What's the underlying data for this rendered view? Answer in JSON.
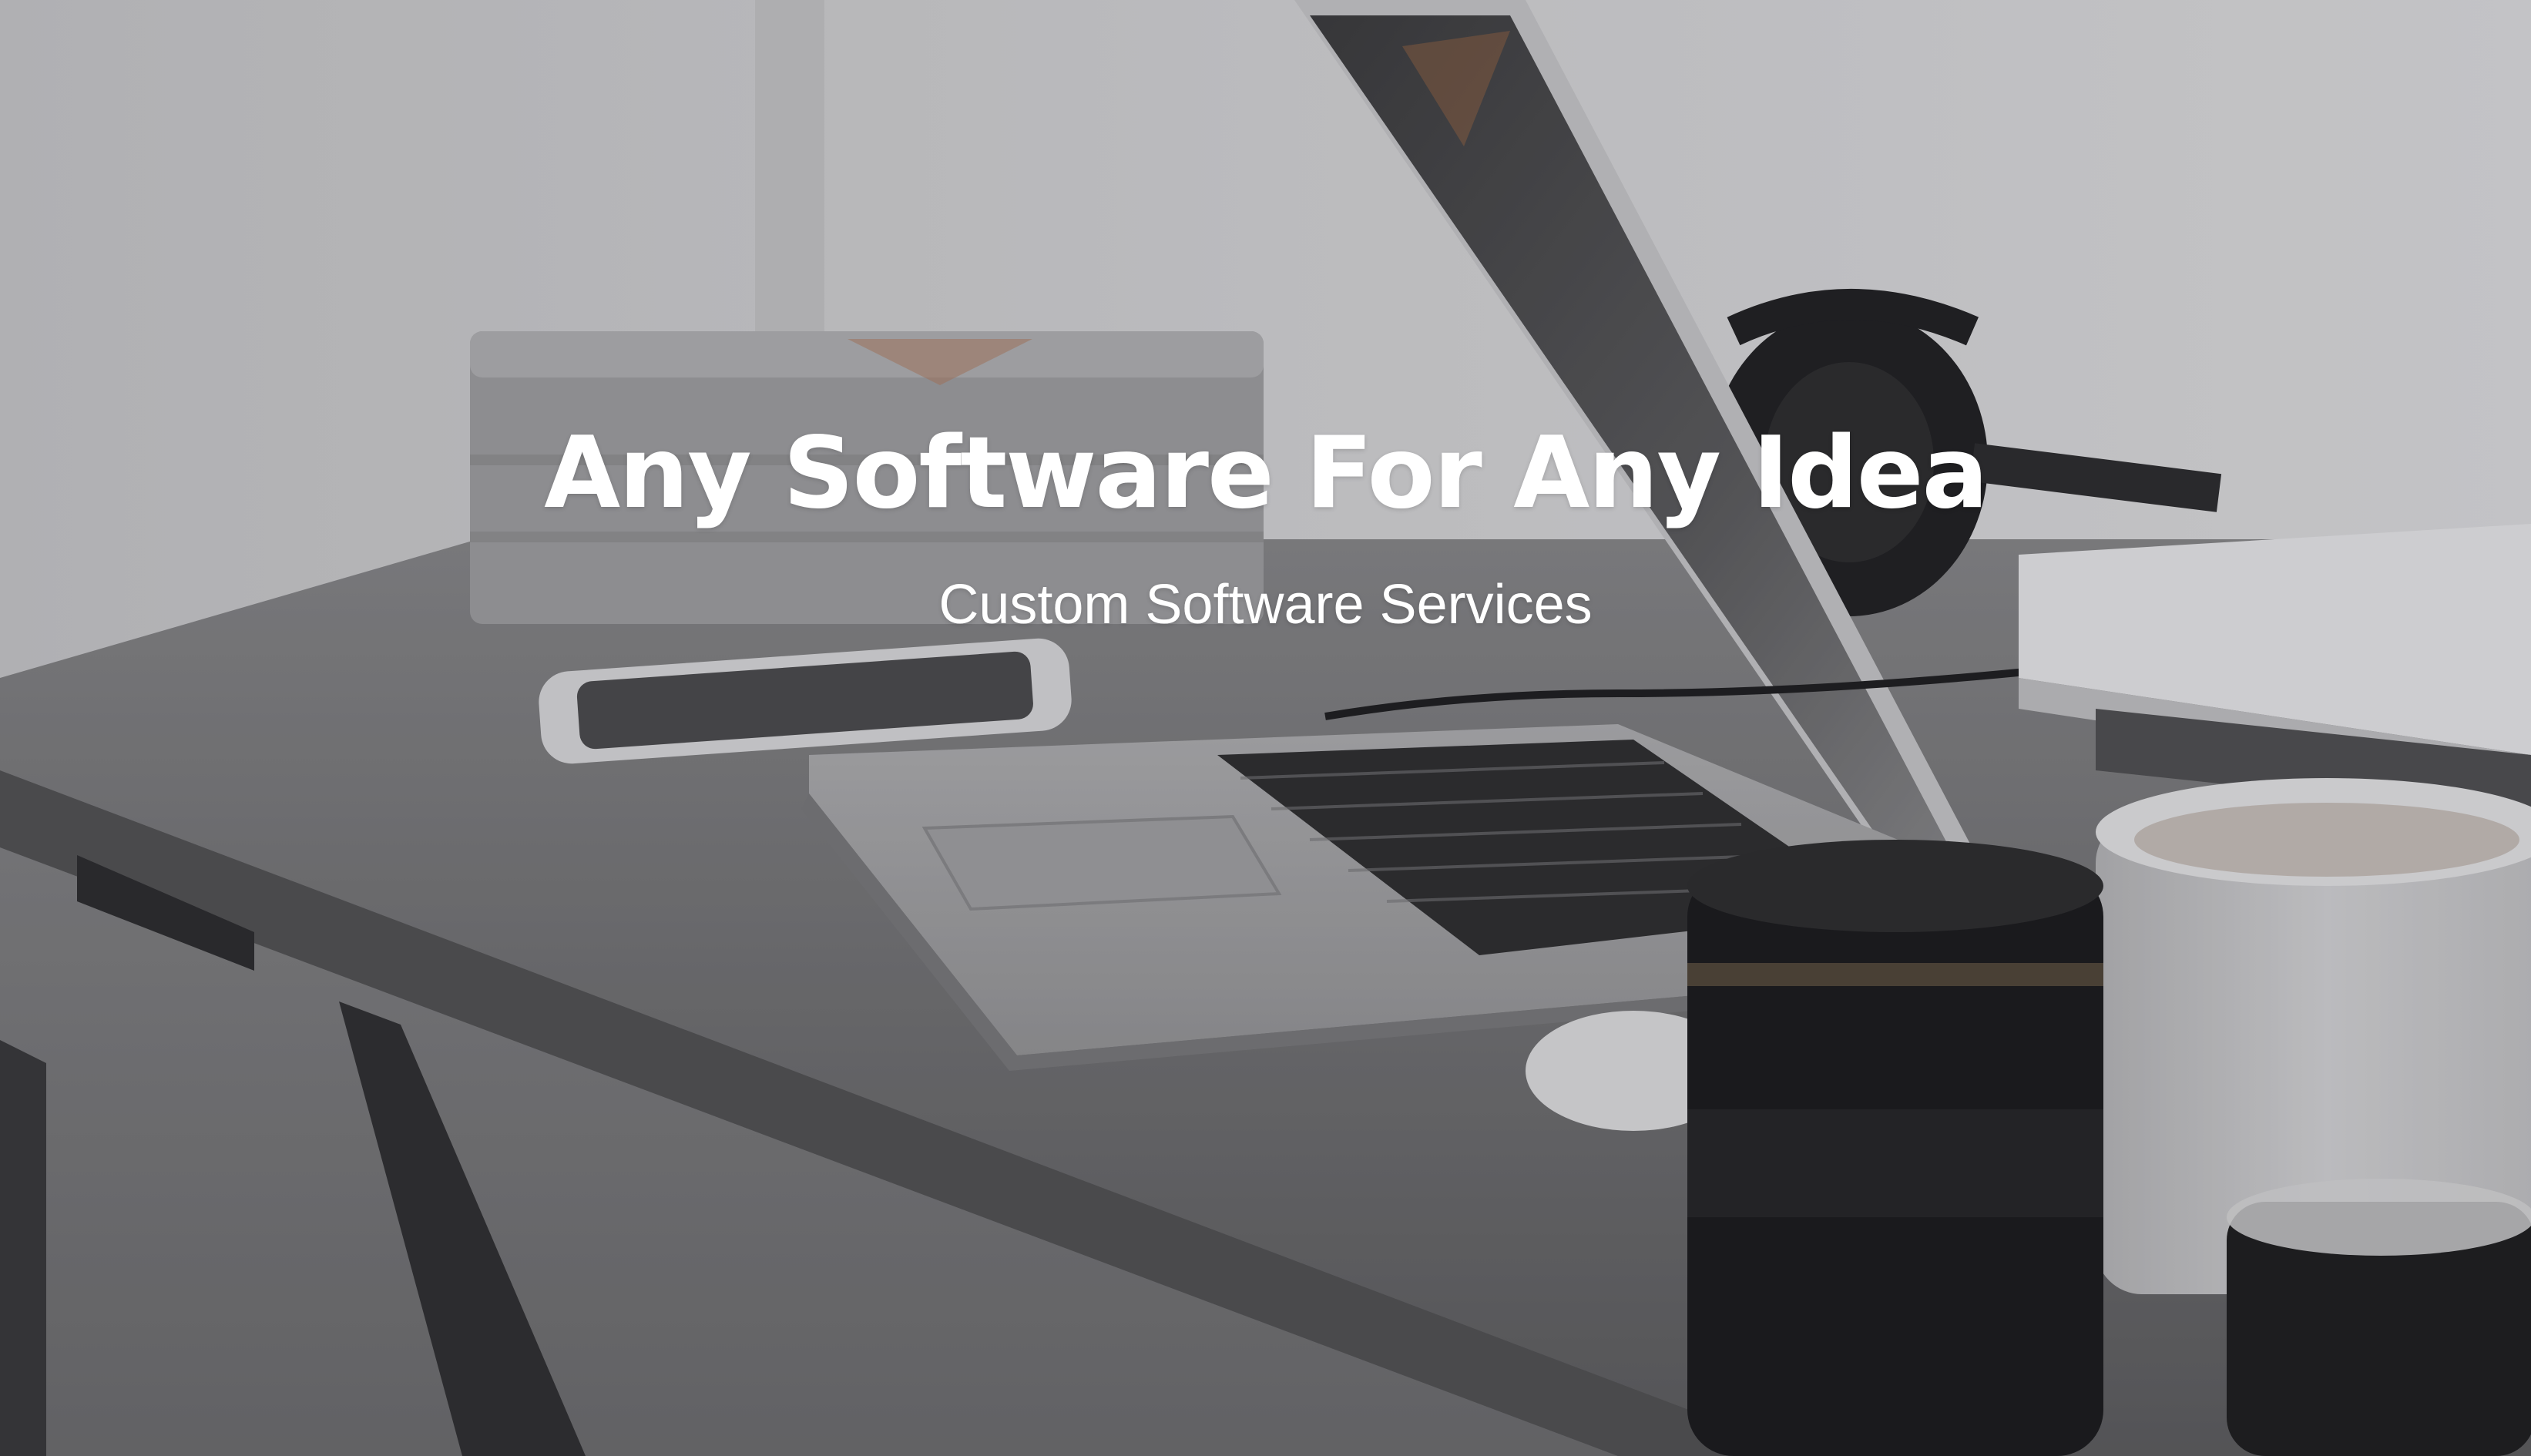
{
  "hero": {
    "title": "Any Software For Any Idea",
    "subtitle": "Custom Software Services"
  },
  "colors": {
    "text": "#ffffff",
    "desk": "#6d6d6f",
    "wall": "#d6d6d8"
  }
}
